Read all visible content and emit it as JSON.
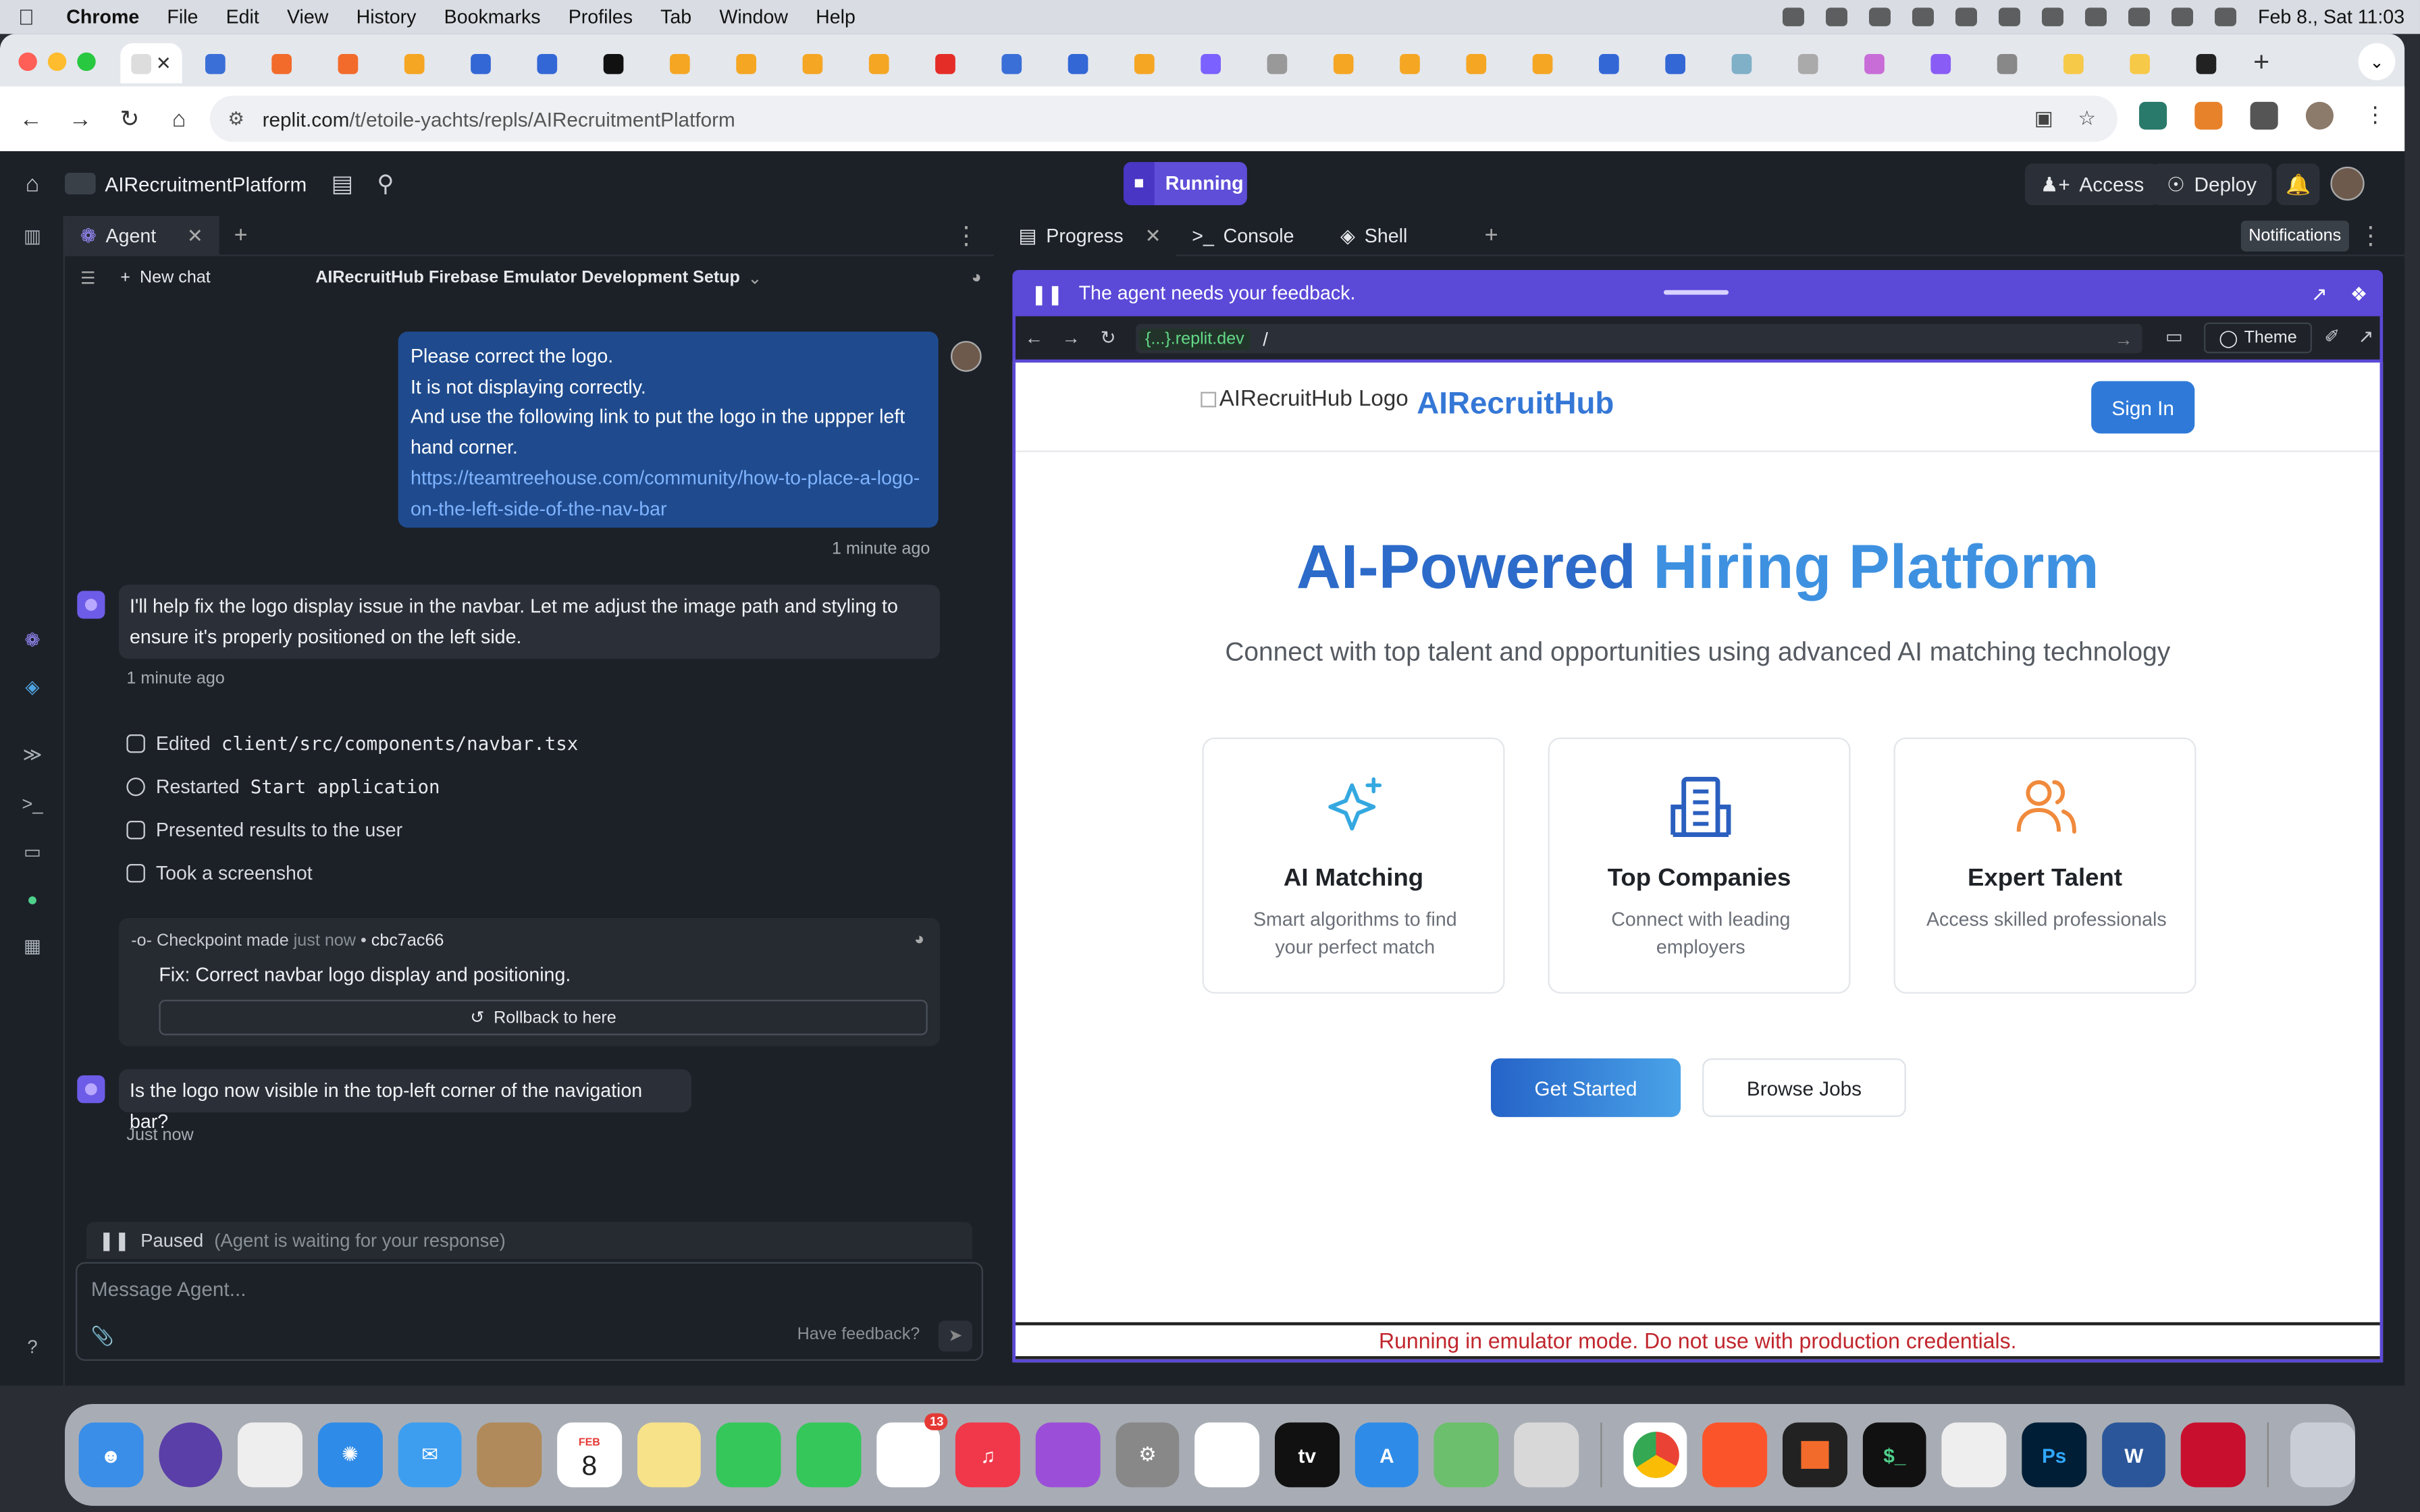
{
  "menubar": {
    "app": "Chrome",
    "items": [
      "File",
      "Edit",
      "View",
      "History",
      "Bookmarks",
      "Profiles",
      "Tab",
      "Window",
      "Help"
    ],
    "clock": "Feb 8., Sat  11:03"
  },
  "browser": {
    "url_domain": "replit.com",
    "url_path": "/t/etoile-yachts/repls/AIRecruitmentPlatform"
  },
  "replit": {
    "app_name": "AIRecruitmentPlatform",
    "run_label": "Running",
    "access_label": "Access",
    "deploy_label": "Deploy",
    "notifications_tooltip": "Notifications"
  },
  "agent": {
    "tab_label": "Agent",
    "new_chat": "New chat",
    "chat_title": "AIRecruitHub Firebase Emulator Development Setup",
    "user_msg": {
      "line1": "Please correct the logo.",
      "line2": "It is not displaying correctly.",
      "line3": "And use the following link to put the logo in the uppper left hand corner.",
      "link": "https://teamtreehouse.com/community/how-to-place-a-logo-on-the-left-side-of-the-nav-bar",
      "time": "1 minute ago"
    },
    "reply": {
      "text": "I'll help fix the logo display issue in the navbar. Let me adjust the image path and styling to ensure it's properly positioned on the left side.",
      "time": "1 minute ago"
    },
    "steps": [
      {
        "label": "Edited",
        "code": "client/src/components/navbar.tsx"
      },
      {
        "label": "Restarted",
        "code": "Start application"
      },
      {
        "label": "Presented results to the user",
        "code": ""
      },
      {
        "label": "Took a screenshot",
        "code": ""
      }
    ],
    "checkpoint": {
      "label": "Checkpoint made",
      "when": "just now",
      "hash": "cbc7ac66",
      "message": "Fix: Correct navbar logo display and positioning.",
      "rollback": "Rollback to here"
    },
    "question": {
      "text": "Is the logo now visible in the top-left corner of the navigation bar?",
      "time": "Just now"
    },
    "paused": "Paused",
    "paused_sub": "(Agent is waiting for your response)",
    "input_placeholder": "Message Agent...",
    "feedback": "Have feedback?"
  },
  "right_panel": {
    "tabs": [
      "Progress",
      "Console",
      "Shell"
    ],
    "feedback_banner": "The agent needs your feedback.",
    "preview_domain": "{...}.replit.dev",
    "preview_path": "/",
    "theme_label": "Theme"
  },
  "site": {
    "logo_alt": "AIRecruitHub Logo",
    "brand": "AIRecruitHub",
    "signin": "Sign In",
    "hero_part1": "AI-Powered",
    "hero_part2": "Hiring Platform",
    "subtitle": "Connect with top talent and opportunities using advanced AI matching technology",
    "cards": [
      {
        "title": "AI Matching",
        "desc": "Smart algorithms to find your perfect match",
        "icon": "sparkles-icon",
        "color": "#35a8e0"
      },
      {
        "title": "Top Companies",
        "desc": "Connect with leading employers",
        "icon": "building-icon",
        "color": "#2a5fbf"
      },
      {
        "title": "Expert Talent",
        "desc": "Access skilled professionals",
        "icon": "users-icon",
        "color": "#f08a3c"
      }
    ],
    "get_started": "Get Started",
    "browse_jobs": "Browse Jobs",
    "emulator_warning": "Running in emulator mode. Do not use with production credentials."
  },
  "dock": {
    "calendar_month": "FEB",
    "calendar_day": "8",
    "reminders_badge": "13"
  }
}
